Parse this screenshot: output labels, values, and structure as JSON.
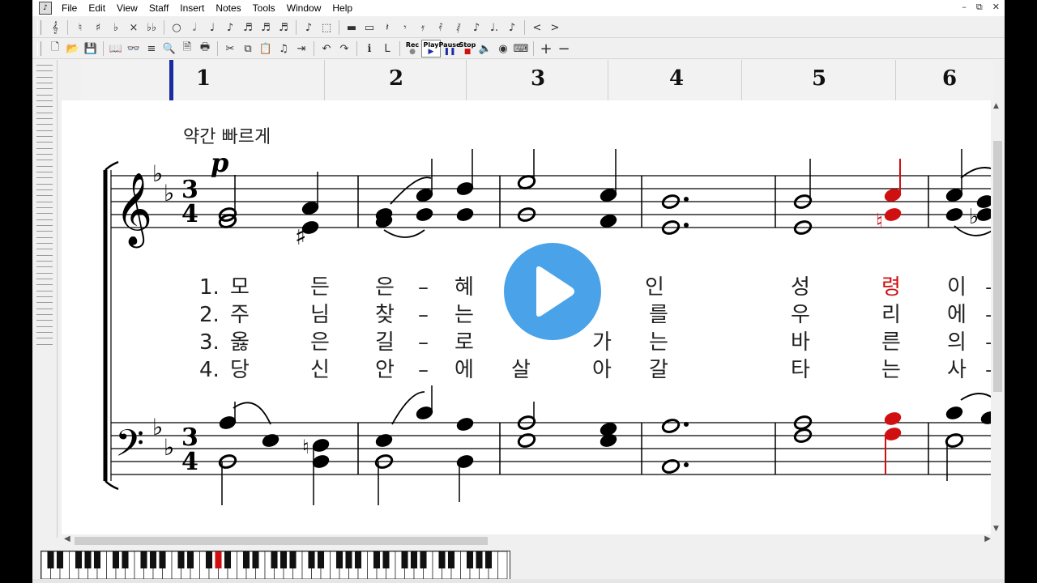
{
  "menu": {
    "items": [
      "File",
      "Edit",
      "View",
      "Staff",
      "Insert",
      "Notes",
      "Tools",
      "Window",
      "Help"
    ]
  },
  "window_controls": {
    "minimize": "–",
    "restore": "⧉",
    "close": "✕"
  },
  "toolbar1": {
    "icons": [
      "clef-icon",
      "natural-icon",
      "sharp-icon",
      "flat-icon",
      "double-sharp-icon",
      "double-flat-icon",
      "whole-note-icon",
      "half-note-icon",
      "quarter-note-icon",
      "eighth-note-icon",
      "sixteenth-note-icon",
      "thirtysecond-note-icon",
      "sixtyfourth-note-icon",
      "grace-note-icon",
      "rest-box-icon",
      "whole-rest-icon",
      "half-rest-icon",
      "quarter-rest-icon",
      "eighth-rest-icon",
      "sixteenth-rest-icon",
      "thirtysecond-rest-icon",
      "sixtyfourth-rest-icon",
      "tuplet-icon",
      "dotted-icon",
      "ties-icon",
      "crescendo-icon",
      "decrescendo-icon"
    ]
  },
  "toolbar2": {
    "rec_label": "Rec",
    "play_label": "Play",
    "pause_label": "Pause",
    "stop_label": "Stop",
    "plus_label": "+",
    "minus_label": "−"
  },
  "ruler": {
    "measures": [
      "1",
      "2",
      "3",
      "4",
      "5",
      "6"
    ]
  },
  "score": {
    "tempo_marking": "약간 빠르게",
    "dynamic": "p",
    "time_signature_top": "3",
    "time_signature_bottom": "4",
    "verses": [
      {
        "number": "1.",
        "syllables": [
          "모",
          "든",
          "은",
          "–",
          "혜",
          "",
          "인",
          "",
          "성",
          "령",
          "이",
          "–"
        ]
      },
      {
        "number": "2.",
        "syllables": [
          "주",
          "님",
          "찾",
          "–",
          "는",
          "",
          "",
          "를",
          "우",
          "리",
          "에",
          "–"
        ]
      },
      {
        "number": "3.",
        "syllables": [
          "옳",
          "은",
          "길",
          "–",
          "로",
          "",
          "가",
          "는",
          "바",
          "른",
          "의",
          "–"
        ]
      },
      {
        "number": "4.",
        "syllables": [
          "당",
          "신",
          "안",
          "–",
          "에",
          "살",
          "아",
          "갈",
          "타",
          "는",
          "사",
          "–"
        ]
      }
    ],
    "highlight_color": "#d01010"
  },
  "overlay": {
    "icon": "play-icon"
  }
}
